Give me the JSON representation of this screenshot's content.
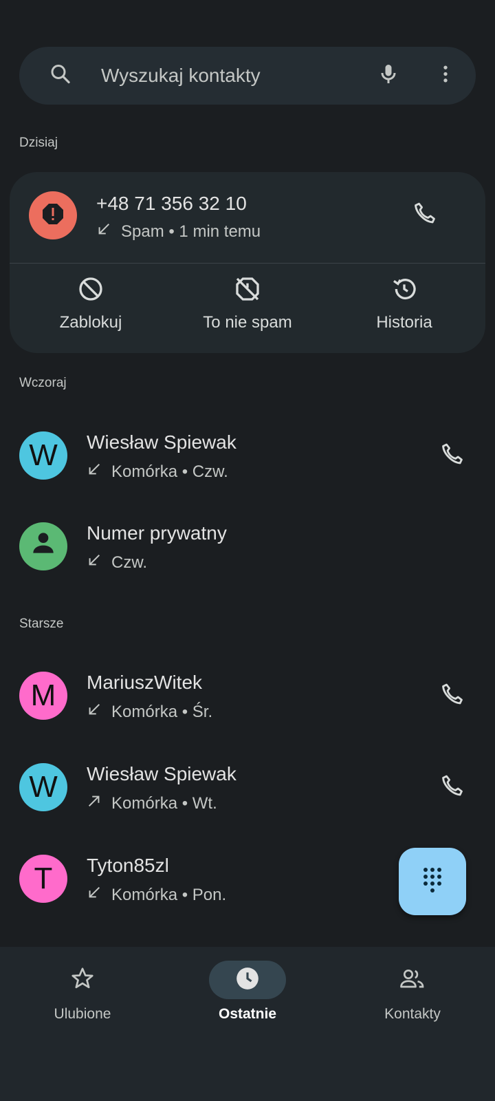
{
  "search": {
    "placeholder": "Wyszukaj kontakty"
  },
  "sections": {
    "today": "Dzisiaj",
    "yesterday": "Wczoraj",
    "older": "Starsze"
  },
  "spam_card": {
    "number": "+48 71 356 32 10",
    "detail": "Spam • 1 min temu",
    "avatar_color": "#ec6e5e",
    "actions": [
      {
        "label": "Zablokuj",
        "icon": "block-icon"
      },
      {
        "label": "To nie spam",
        "icon": "not-spam-icon"
      },
      {
        "label": "Historia",
        "icon": "history-icon"
      }
    ]
  },
  "calls": [
    {
      "initial": "W",
      "name": "Wiesław Spiewak",
      "detail": "Komórka • Czw.",
      "direction": "incoming",
      "avatar_color": "#4ec6e0",
      "has_call": true
    },
    {
      "initial": "",
      "name": "Numer prywatny",
      "detail": "Czw.",
      "direction": "incoming",
      "avatar_color": "#5bb974",
      "has_call": false
    },
    {
      "initial": "M",
      "name": "MariuszWitek",
      "detail": "Komórka • Śr.",
      "direction": "incoming",
      "avatar_color": "#ff6bcb",
      "has_call": true
    },
    {
      "initial": "W",
      "name": "Wiesław Spiewak",
      "detail": "Komórka • Wt.",
      "direction": "outgoing",
      "avatar_color": "#4ec6e0",
      "has_call": true
    },
    {
      "initial": "T",
      "name": "Tyton85zl",
      "detail": "Komórka • Pon.",
      "direction": "incoming",
      "avatar_color": "#ff6bcb",
      "has_call": false
    }
  ],
  "fab": {
    "icon": "dialpad-icon",
    "color": "#8fd0f7"
  },
  "nav": [
    {
      "label": "Ulubione",
      "icon": "star-icon",
      "active": false
    },
    {
      "label": "Ostatnie",
      "icon": "clock-icon",
      "active": true
    },
    {
      "label": "Kontakty",
      "icon": "people-icon",
      "active": false
    }
  ]
}
